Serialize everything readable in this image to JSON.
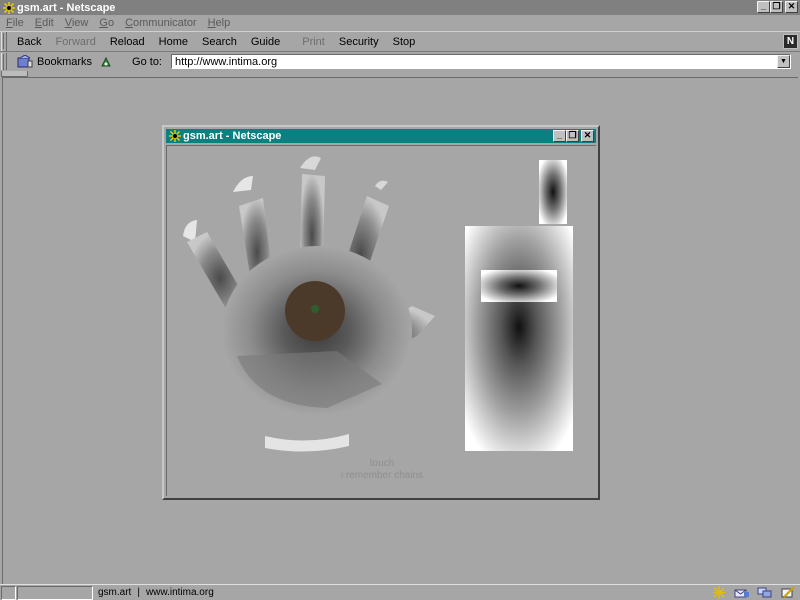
{
  "window": {
    "title": "gsm.art - Netscape",
    "icon": "netscape-star-icon"
  },
  "menu": {
    "items": [
      {
        "label": "File",
        "key": "F"
      },
      {
        "label": "Edit",
        "key": "E"
      },
      {
        "label": "View",
        "key": "V"
      },
      {
        "label": "Go",
        "key": "G"
      },
      {
        "label": "Communicator",
        "key": "C"
      },
      {
        "label": "Help",
        "key": "H"
      }
    ]
  },
  "toolbar": {
    "back": "Back",
    "forward": "Forward",
    "reload": "Reload",
    "home": "Home",
    "search": "Search",
    "guide": "Guide",
    "print": "Print",
    "security": "Security",
    "stop": "Stop",
    "logo": "N"
  },
  "location": {
    "bookmarks_label": "Bookmarks",
    "goto_label": "Go to:",
    "url": "http://www.intima.org"
  },
  "popup": {
    "title": "gsm.art - Netscape",
    "caption_line1": "touch",
    "caption_line2": "i remember chains"
  },
  "status": {
    "page_name": "gsm.art",
    "separator": "|",
    "url": "www.intima.org"
  },
  "colors": {
    "title_active": "#0b8080",
    "title_inactive": "#808080",
    "desktop_gray": "#a6a6a6",
    "palm_center": "#4b3a2a",
    "center_dot": "#2e5e2e"
  }
}
